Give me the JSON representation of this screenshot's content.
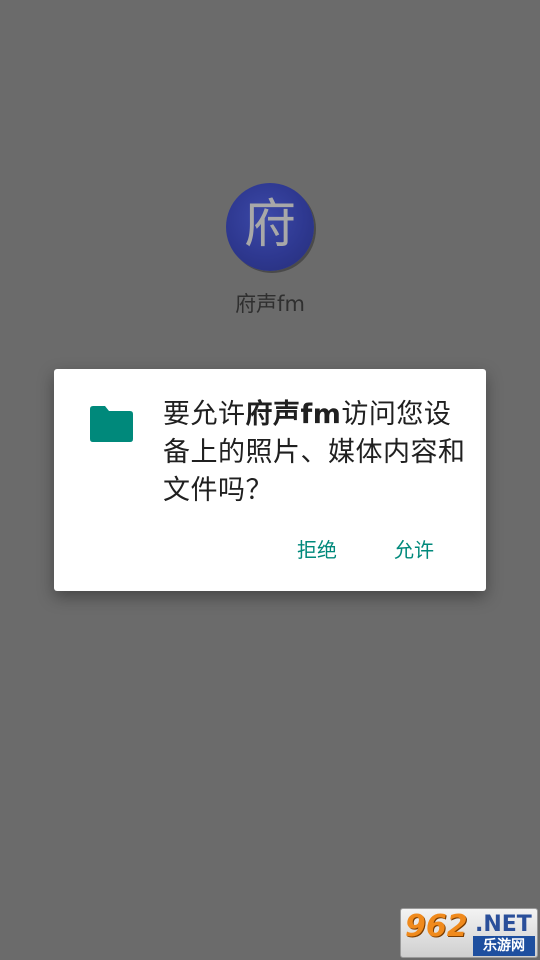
{
  "app": {
    "icon_char": "府",
    "name": "府声fm"
  },
  "dialog": {
    "icon": "folder-icon",
    "message_prefix": "要允许",
    "message_app": "府声fm",
    "message_suffix": "访问您设备上的照片、媒体内容和文件吗？",
    "deny_label": "拒绝",
    "allow_label": "允许",
    "accent_color": "#00897b",
    "icon_color": "#00897b"
  },
  "watermark": {
    "number": "962",
    "domain": ".NET",
    "site_name": "乐游网"
  }
}
